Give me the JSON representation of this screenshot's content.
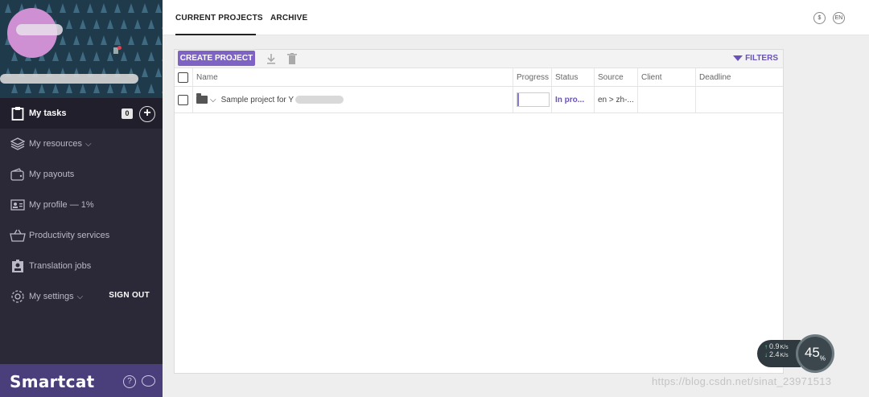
{
  "sidebar": {
    "menu": [
      {
        "label": "My tasks",
        "icon": "clipboard-icon",
        "count": "0"
      },
      {
        "label": "My resources",
        "icon": "layers-icon"
      },
      {
        "label": "My payouts",
        "icon": "wallet-icon"
      },
      {
        "label": "My profile — 1%",
        "icon": "id-card-icon"
      },
      {
        "label": "Productivity services",
        "icon": "basket-icon"
      },
      {
        "label": "Translation jobs",
        "icon": "badge-icon"
      },
      {
        "label": "My settings",
        "icon": "gear-icon"
      }
    ],
    "sign_out": "SIGN OUT",
    "brand": "Smartcat",
    "help_symbol": "?"
  },
  "topbar": {
    "tabs": [
      "CURRENT PROJECTS",
      "ARCHIVE"
    ],
    "active_tab": "CURRENT PROJECTS",
    "currency_symbol": "$",
    "language": "EN"
  },
  "toolbar": {
    "create_label": "CREATE PROJECT",
    "filters_label": "FILTERS"
  },
  "table": {
    "columns": [
      "Name",
      "Progress",
      "Status",
      "Source",
      "Client",
      "Deadline"
    ],
    "rows": [
      {
        "name": "Sample project for Y",
        "progress": 0.05,
        "status": "In pro...",
        "source": "en > zh-...",
        "client": "",
        "deadline": ""
      }
    ]
  },
  "speed_widget": {
    "upload": "0.9",
    "upload_unit": "K/s",
    "download": "2.4",
    "download_unit": "K/s",
    "percent": "45",
    "percent_unit": "%"
  },
  "watermark": "https://blog.csdn.net/sinat_23971513",
  "colors": {
    "accent": "#7e62c4",
    "sidebar": "#2b2838",
    "brand_bar": "#4a3f7a"
  }
}
